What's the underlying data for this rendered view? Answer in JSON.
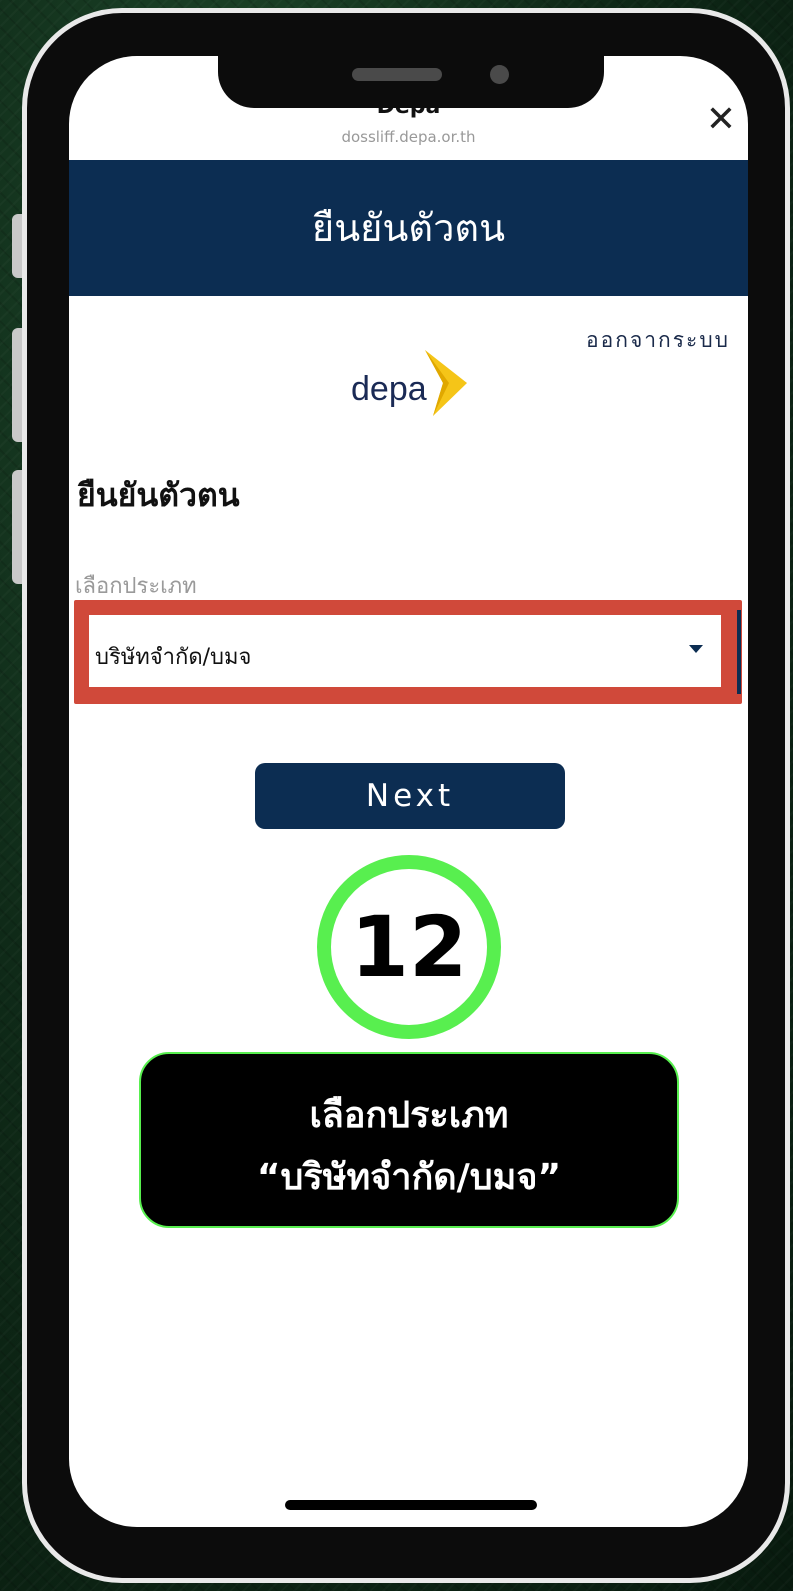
{
  "browser": {
    "title": "Depa",
    "url": "dossliff.depa.or.th",
    "close_icon": "close-icon"
  },
  "header": {
    "title": "ยืนยันตัวตน"
  },
  "logout": {
    "label": "ออกจากระบบ"
  },
  "logo": {
    "text": "depa",
    "accent_color": "#f5c518"
  },
  "form": {
    "section_title": "ยืนยันตัวตน",
    "type_label": "เลือกประเภท",
    "type_selected": "บริษัทจำกัด/บมจ",
    "dropdown_icon": "chevron-down-icon"
  },
  "next_button": {
    "label": "Next"
  },
  "step": {
    "number": "12",
    "instruction_line1": "เลือกประเภท",
    "instruction_line2": "“บริษัทจำกัด/บมจ”"
  },
  "colors": {
    "header_bg": "#0c2d52",
    "highlight": "#d0493a",
    "step_green": "#58ef4f"
  }
}
